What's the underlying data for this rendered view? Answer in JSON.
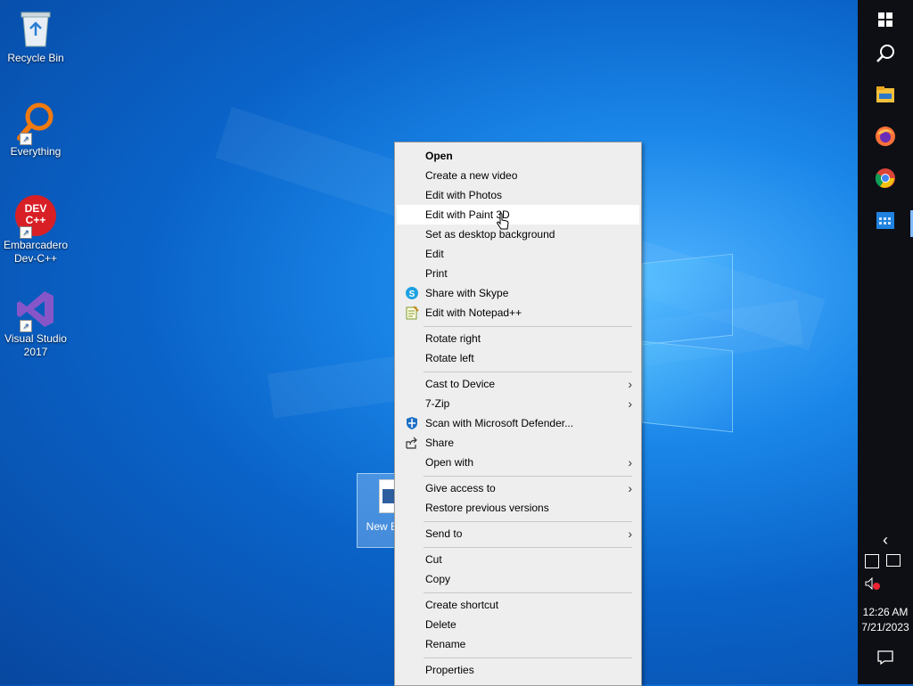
{
  "desktop": {
    "icons": [
      {
        "label": "Recycle Bin",
        "icon": "recycle-bin-icon"
      },
      {
        "label": "Everything",
        "icon": "everything-search-icon"
      },
      {
        "label": "Embarcadero Dev-C++",
        "icon": "devcpp-icon",
        "icon_text": "DEV C++"
      },
      {
        "label": "Visual Studio 2017",
        "icon": "visual-studio-icon"
      }
    ],
    "selected_file": {
      "label": "New B Ima",
      "icon": "image-file-icon"
    }
  },
  "context_menu": {
    "items": [
      {
        "label": "Open",
        "bold": true
      },
      {
        "label": "Create a new video"
      },
      {
        "label": "Edit with Photos"
      },
      {
        "label": "Edit with Paint 3D",
        "hover": true
      },
      {
        "label": "Set as desktop background"
      },
      {
        "label": "Edit"
      },
      {
        "label": "Print"
      },
      {
        "label": "Share with Skype",
        "icon": "skype-icon"
      },
      {
        "label": "Edit with Notepad++",
        "icon": "notepadpp-icon"
      },
      {
        "label": "Rotate right"
      },
      {
        "label": "Rotate left"
      },
      {
        "label": "Cast to Device",
        "submenu": true
      },
      {
        "label": "7-Zip",
        "submenu": true
      },
      {
        "label": "Scan with Microsoft Defender...",
        "icon": "defender-shield-icon"
      },
      {
        "label": "Share",
        "icon": "share-icon"
      },
      {
        "label": "Open with",
        "submenu": true
      },
      {
        "label": "Give access to",
        "submenu": true
      },
      {
        "label": "Restore previous versions"
      },
      {
        "label": "Send to",
        "submenu": true
      },
      {
        "label": "Cut"
      },
      {
        "label": "Copy"
      },
      {
        "label": "Create shortcut"
      },
      {
        "label": "Delete"
      },
      {
        "label": "Rename"
      },
      {
        "label": "Properties"
      }
    ]
  },
  "taskbar": {
    "buttons": [
      "windows-start-icon",
      "search-icon",
      "file-explorer-icon",
      "firefox-icon",
      "chrome-icon",
      "calendar-app-icon"
    ],
    "tray": {
      "time": "12:26 AM",
      "date": "7/21/2023"
    }
  },
  "colors": {
    "desktop_blue": "#0a63c8",
    "taskbar": "#0d0f14",
    "menu_bg": "#eeeeee"
  }
}
